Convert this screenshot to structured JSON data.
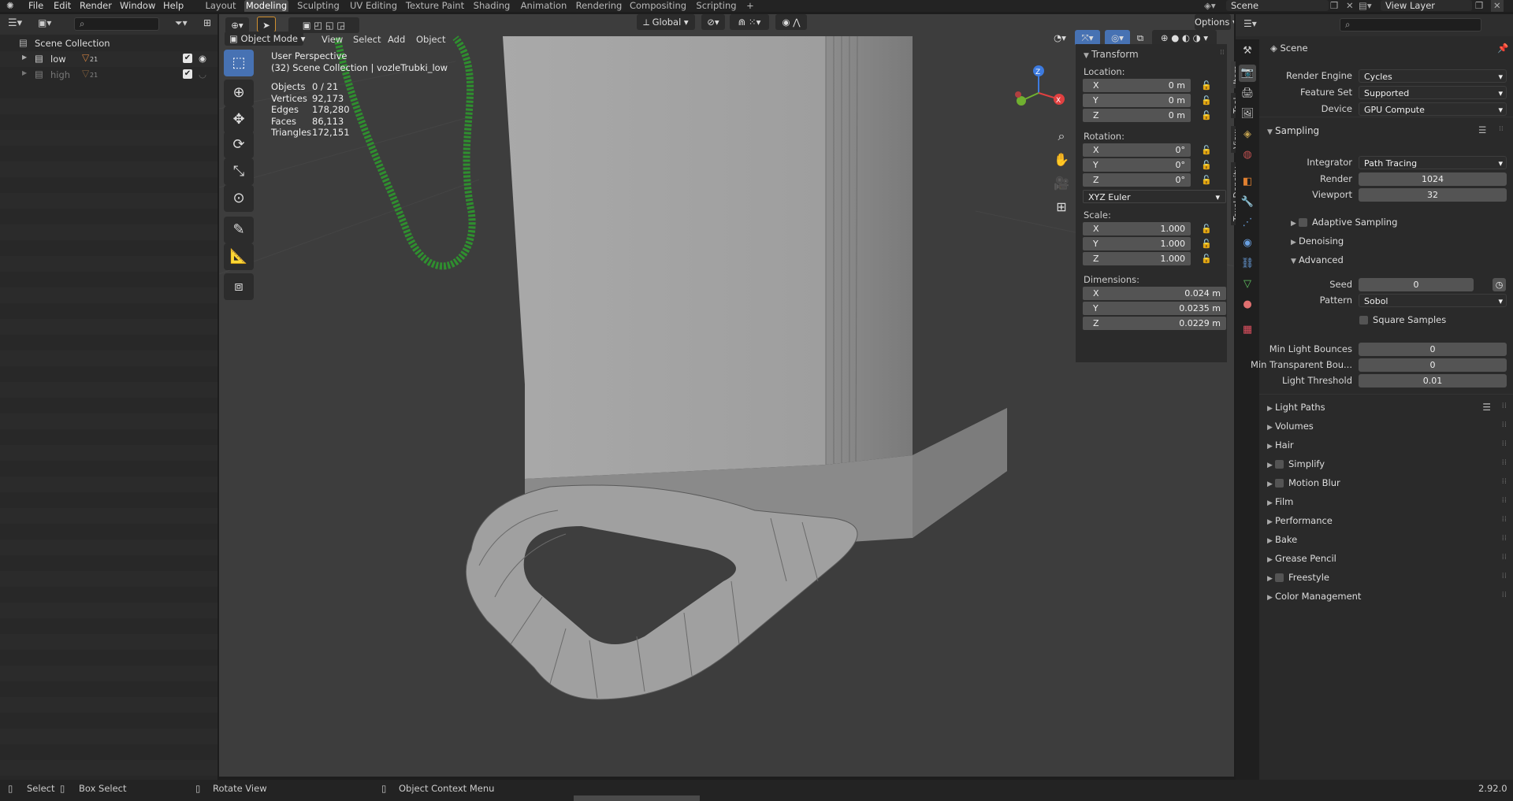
{
  "topbar": {
    "menus": [
      "File",
      "Edit",
      "Render",
      "Window",
      "Help"
    ],
    "workspaces": [
      "Layout",
      "Modeling",
      "Sculpting",
      "UV Editing",
      "Texture Paint",
      "Shading",
      "Animation",
      "Rendering",
      "Compositing",
      "Scripting"
    ],
    "active_workspace": "Modeling",
    "add_tab": "+",
    "scene": "Scene",
    "view_layer": "View Layer"
  },
  "outliner": {
    "search_placeholder": "",
    "root": "Scene Collection",
    "items": [
      {
        "name": "low",
        "badge": "21",
        "checked": true,
        "visible": true
      },
      {
        "name": "high",
        "badge": "21",
        "checked": true,
        "visible": false
      }
    ]
  },
  "viewport": {
    "mode": "Object Mode",
    "menus": [
      "View",
      "Select",
      "Add",
      "Object"
    ],
    "orientation": "Global",
    "options": "Options",
    "perspective": "User Perspective",
    "collection": "(32) Scene Collection | vozleTrubki_low",
    "stats": [
      {
        "label": "Objects",
        "value": "0 / 21"
      },
      {
        "label": "Vertices",
        "value": "92,173"
      },
      {
        "label": "Edges",
        "value": "178,280"
      },
      {
        "label": "Faces",
        "value": "86,113"
      },
      {
        "label": "Triangles",
        "value": "172,151"
      }
    ]
  },
  "transform": {
    "title": "Transform",
    "location_label": "Location:",
    "location": [
      {
        "axis": "X",
        "value": "0 m"
      },
      {
        "axis": "Y",
        "value": "0 m"
      },
      {
        "axis": "Z",
        "value": "0 m"
      }
    ],
    "rotation_label": "Rotation:",
    "rotation": [
      {
        "axis": "X",
        "value": "0°"
      },
      {
        "axis": "Y",
        "value": "0°"
      },
      {
        "axis": "Z",
        "value": "0°"
      }
    ],
    "rotation_mode": "XYZ Euler",
    "scale_label": "Scale:",
    "scale": [
      {
        "axis": "X",
        "value": "1.000"
      },
      {
        "axis": "Y",
        "value": "1.000"
      },
      {
        "axis": "Z",
        "value": "1.000"
      }
    ],
    "dimensions_label": "Dimensions:",
    "dimensions": [
      {
        "axis": "X",
        "value": "0.024 m"
      },
      {
        "axis": "Y",
        "value": "0.0235 m"
      },
      {
        "axis": "Z",
        "value": "0.0229 m"
      }
    ]
  },
  "npanel_tabs": [
    "Item",
    "Tool",
    "View",
    "Texel Density"
  ],
  "properties": {
    "scene_name": "Scene",
    "render_engine_label": "Render Engine",
    "render_engine": "Cycles",
    "feature_set_label": "Feature Set",
    "feature_set": "Supported",
    "device_label": "Device",
    "device": "GPU Compute",
    "sampling": "Sampling",
    "integrator_label": "Integrator",
    "integrator": "Path Tracing",
    "render_label": "Render",
    "render_value": "1024",
    "viewport_label": "Viewport",
    "viewport_value": "32",
    "adaptive_sampling": "Adaptive Sampling",
    "denoising": "Denoising",
    "advanced": "Advanced",
    "seed_label": "Seed",
    "seed_value": "0",
    "pattern_label": "Pattern",
    "pattern_value": "Sobol",
    "square_samples": "Square Samples",
    "min_light_bounces_label": "Min Light Bounces",
    "min_light_bounces": "0",
    "min_transparent_label": "Min Transparent Bou...",
    "min_transparent": "0",
    "light_threshold_label": "Light Threshold",
    "light_threshold": "0.01",
    "panels": [
      {
        "label": "Light Paths",
        "checkbox": false
      },
      {
        "label": "Volumes",
        "checkbox": false
      },
      {
        "label": "Hair",
        "checkbox": false
      },
      {
        "label": "Simplify",
        "checkbox": true
      },
      {
        "label": "Motion Blur",
        "checkbox": true
      },
      {
        "label": "Film",
        "checkbox": false
      },
      {
        "label": "Performance",
        "checkbox": false
      },
      {
        "label": "Bake",
        "checkbox": false
      },
      {
        "label": "Grease Pencil",
        "checkbox": false
      },
      {
        "label": "Freestyle",
        "checkbox": true
      },
      {
        "label": "Color Management",
        "checkbox": false
      }
    ]
  },
  "statusbar": {
    "select": "Select",
    "box_select": "Box Select",
    "rotate_view": "Rotate View",
    "context_menu": "Object Context Menu",
    "version": "2.92.0"
  },
  "colors": {
    "accent": "#4772b3",
    "active_tool": "#4772b3",
    "mesh": "#9a9a9a",
    "wire": "#2a8a2a"
  }
}
